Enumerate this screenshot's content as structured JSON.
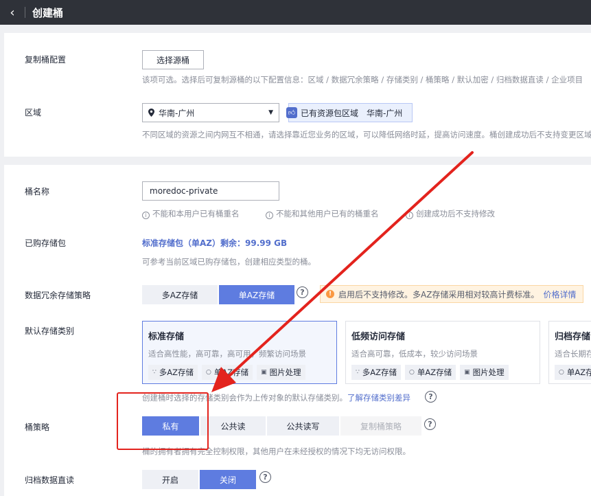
{
  "header": {
    "back_icon": "chevron-left-icon",
    "title": "创建桶"
  },
  "replicate": {
    "label": "复制桶配置",
    "button": "选择源桶",
    "hint": "该项可选。选择后可复制源桶的以下配置信息：区域 / 数据冗余策略 / 存储类别 / 桶策略 / 默认加密 / 归档数据直读 / 企业项目"
  },
  "region": {
    "label": "区域",
    "value": "华南-广州",
    "tag_prefix": "已有资源包区域",
    "tag_value": "华南-广州",
    "hint": "不同区域的资源之间内网互不相通，请选择靠近您业务的区域，可以降低网络时延，提高访问速度。桶创建成功后不支持变更区域"
  },
  "bucket_name": {
    "label": "桶名称",
    "value": "moredoc-private",
    "rules": [
      "不能和本用户已有桶重名",
      "不能和其他用户已有的桶重名",
      "创建成功后不支持修改"
    ]
  },
  "package": {
    "label": "已购存储包",
    "value": "标准存储包（单AZ）剩余：99.99 GB",
    "hint": "可参考当前区域已购存储包，创建相应类型的桶。"
  },
  "redundancy": {
    "label": "数据冗余存储策略",
    "options": [
      "多AZ存储",
      "单AZ存储"
    ],
    "selected": 1,
    "warning": "启用后不支持修改。多AZ存储采用相对较高计费标准。",
    "warning_link": "价格详情"
  },
  "storage_class": {
    "label": "默认存储类别",
    "cards": [
      {
        "title": "标准存储",
        "desc": "适合高性能，高可靠，高可用，频繁访问场景",
        "features": [
          "多AZ存储",
          "单AZ存储",
          "图片处理"
        ]
      },
      {
        "title": "低频访问存储",
        "desc": "适合高可靠，低成本，较少访问场景",
        "features": [
          "多AZ存储",
          "单AZ存储",
          "图片处理"
        ]
      },
      {
        "title": "归档存储",
        "desc": "适合长期存储",
        "features": [
          "单AZ存储"
        ]
      }
    ],
    "hint": "创建桶时选择的存储类别会作为上传对象的默认存储类别。",
    "hint_link": "了解存储类别差异"
  },
  "policy": {
    "label": "桶策略",
    "options": [
      "私有",
      "公共读",
      "公共读写",
      "复制桶策略"
    ],
    "hint": "桶的拥有者拥有完全控制权限，其他用户在未经授权的情况下均无访问权限。"
  },
  "archive_read": {
    "label": "归档数据直读",
    "options": [
      "开启",
      "关闭"
    ]
  },
  "annotation": {
    "arrow_color": "#e3231d",
    "box_color": "#e3231d"
  }
}
